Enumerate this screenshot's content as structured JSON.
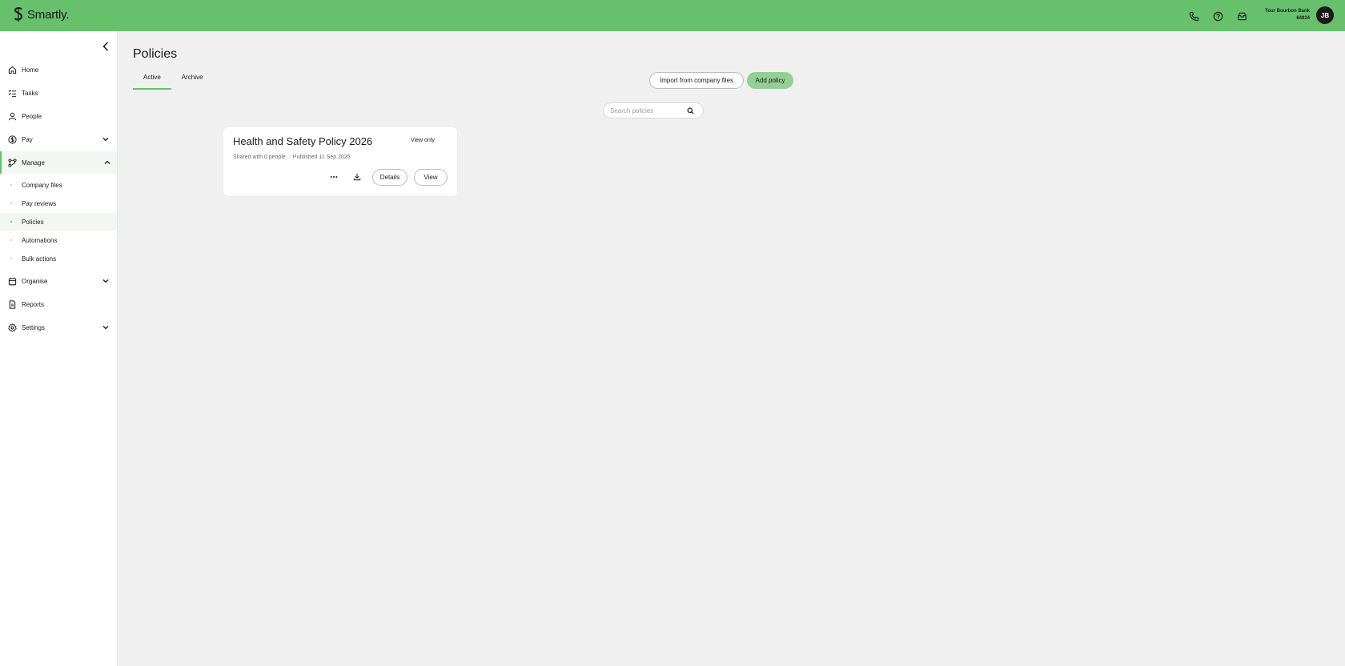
{
  "app": {
    "brand": "Smartly.",
    "brand_color": "#66c06c"
  },
  "topbar": {
    "icons": [
      "phone-icon",
      "help-icon",
      "inbox-icon"
    ],
    "account_line1": "Tour Bourbon Bank",
    "account_line2": "64924",
    "avatar_initials": "JB"
  },
  "sidebar": {
    "items": [
      {
        "label": "Home",
        "icon": "home-icon"
      },
      {
        "label": "Tasks",
        "icon": "tasks-icon"
      },
      {
        "label": "People",
        "icon": "person-icon"
      },
      {
        "label": "Pay",
        "icon": "dollar-icon"
      },
      {
        "label": "Manage",
        "icon": "manage-icon"
      },
      {
        "label": "Organise",
        "icon": "calendar-icon"
      },
      {
        "label": "Reports",
        "icon": "document-icon"
      },
      {
        "label": "Settings",
        "icon": "gear-icon"
      }
    ],
    "manage_sub": [
      {
        "label": "Company files"
      },
      {
        "label": "Pay reviews"
      },
      {
        "label": "Policies"
      },
      {
        "label": "Automations"
      },
      {
        "label": "Bulk actions"
      }
    ]
  },
  "main": {
    "title": "Policies",
    "tabs": [
      {
        "label": "Active"
      },
      {
        "label": "Archive"
      }
    ],
    "import_button": "Import from company files",
    "add_button": "Add policy",
    "search": {
      "placeholder": "Search policies",
      "value": ""
    },
    "policy": {
      "title": "Health and Safety Policy 2026",
      "badge": "View only",
      "shared": "Shared with 0 people",
      "published": "Published 11 Sep 2026",
      "details_button": "Details",
      "view_button": "View"
    }
  }
}
